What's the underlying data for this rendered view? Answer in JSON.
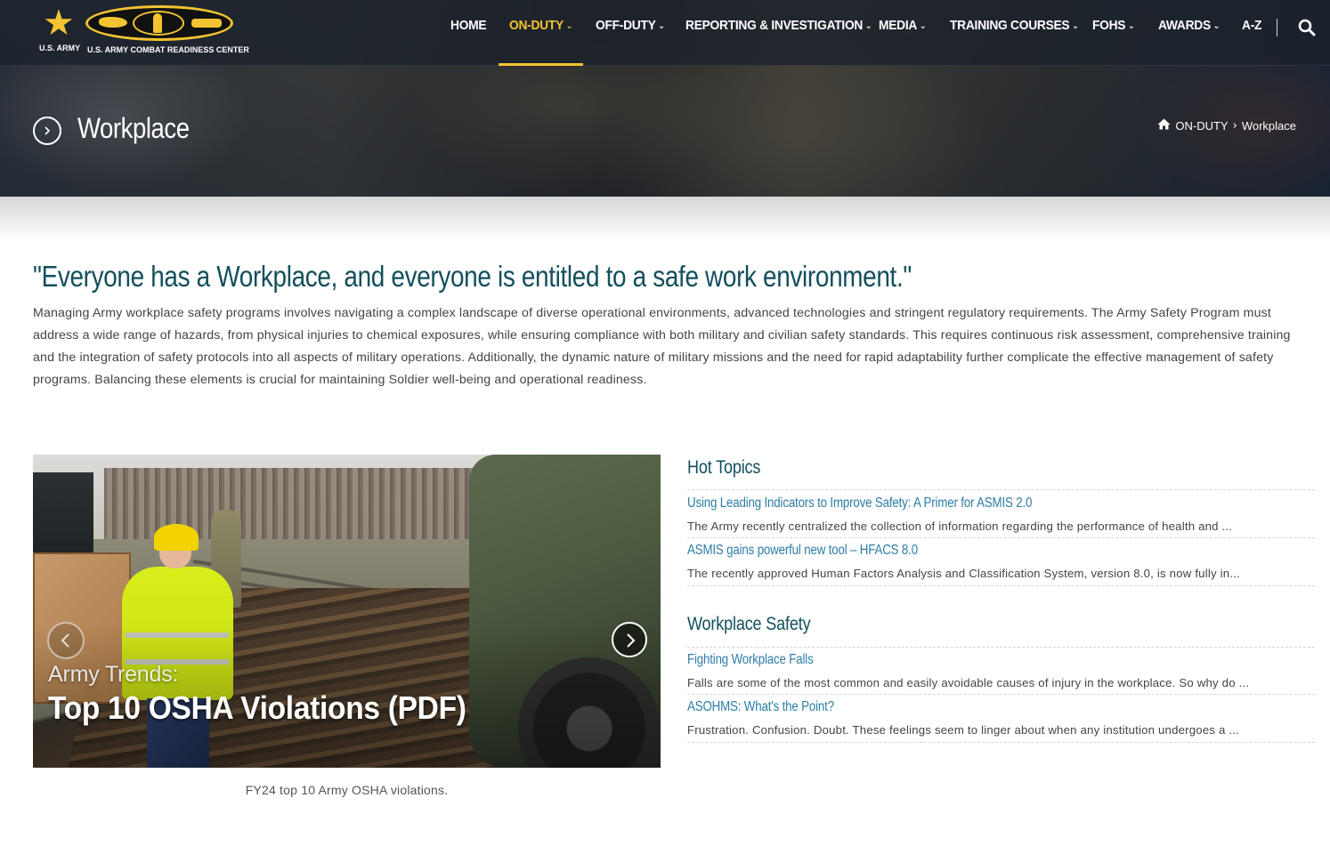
{
  "logo": {
    "army_text": "U.S. ARMY",
    "crc_text": "U.S. ARMY COMBAT READINESS CENTER"
  },
  "nav": {
    "items": [
      {
        "label": "HOME",
        "dropdown": false
      },
      {
        "label": "ON-DUTY",
        "dropdown": true,
        "active": true
      },
      {
        "label": "OFF-DUTY",
        "dropdown": true
      },
      {
        "label": "REPORTING & INVESTIGATION",
        "dropdown": true
      },
      {
        "label": "MEDIA",
        "dropdown": true
      },
      {
        "label": "TRAINING COURSES",
        "dropdown": true
      },
      {
        "label": "FOHS",
        "dropdown": true
      },
      {
        "label": "AWARDS",
        "dropdown": true
      },
      {
        "label": "A-Z",
        "dropdown": false
      }
    ],
    "chevron": "⌄",
    "search_icon": "search-icon"
  },
  "page": {
    "title": "Workplace",
    "breadcrumb": {
      "home_icon": "home-icon",
      "parent": "ON-DUTY",
      "separator": "›",
      "current": "Workplace"
    }
  },
  "intro": {
    "headline": "\"Everyone has a Workplace, and everyone is entitled to a safe work environment.\"",
    "body": "Managing Army workplace safety programs involves navigating a complex landscape of diverse operational environments, advanced technologies and stringent regulatory requirements. The Army Safety Program must address a wide range of hazards, from physical injuries to chemical exposures, while ensuring compliance with both military and civilian safety standards. This requires continuous risk assessment, comprehensive training and the integration of safety protocols into all aspects of military operations. Additionally, the dynamic nature of military missions and the need for rapid adaptability further complicate the effective management of safety programs. Balancing these elements is crucial for maintaining Soldier well-being and operational readiness."
  },
  "carousel": {
    "caption_line1": "Army Trends:",
    "caption_line2": "Top 10 OSHA Violations (PDF)",
    "description": "FY24 top 10 Army OSHA violations."
  },
  "hot_topics": {
    "title": "Hot Topics",
    "articles": [
      {
        "title": "Using Leading Indicators to Improve Safety: A Primer for ASMIS 2.0",
        "summary": "The Army recently centralized the collection of information regarding the performance of health and ..."
      },
      {
        "title": "ASMIS gains powerful new tool – HFACS 8.0",
        "summary": "The recently approved Human Factors Analysis and Classification System, version 8.0, is now fully in..."
      }
    ]
  },
  "workplace_safety": {
    "title": "Workplace Safety",
    "articles": [
      {
        "title": "Fighting Workplace Falls",
        "summary": "Falls are some of the most common and easily avoidable causes of injury in the workplace. So why do ..."
      },
      {
        "title": "ASOHMS: What's the Point?",
        "summary": "Frustration. Confusion. Doubt. These feelings seem to linger about when any institution undergoes a ..."
      }
    ]
  },
  "colors": {
    "accent_gold": "#f2c431",
    "heading_teal": "#134f5c",
    "link_blue": "#2e7da6",
    "nav_bg": "#1c222c"
  }
}
